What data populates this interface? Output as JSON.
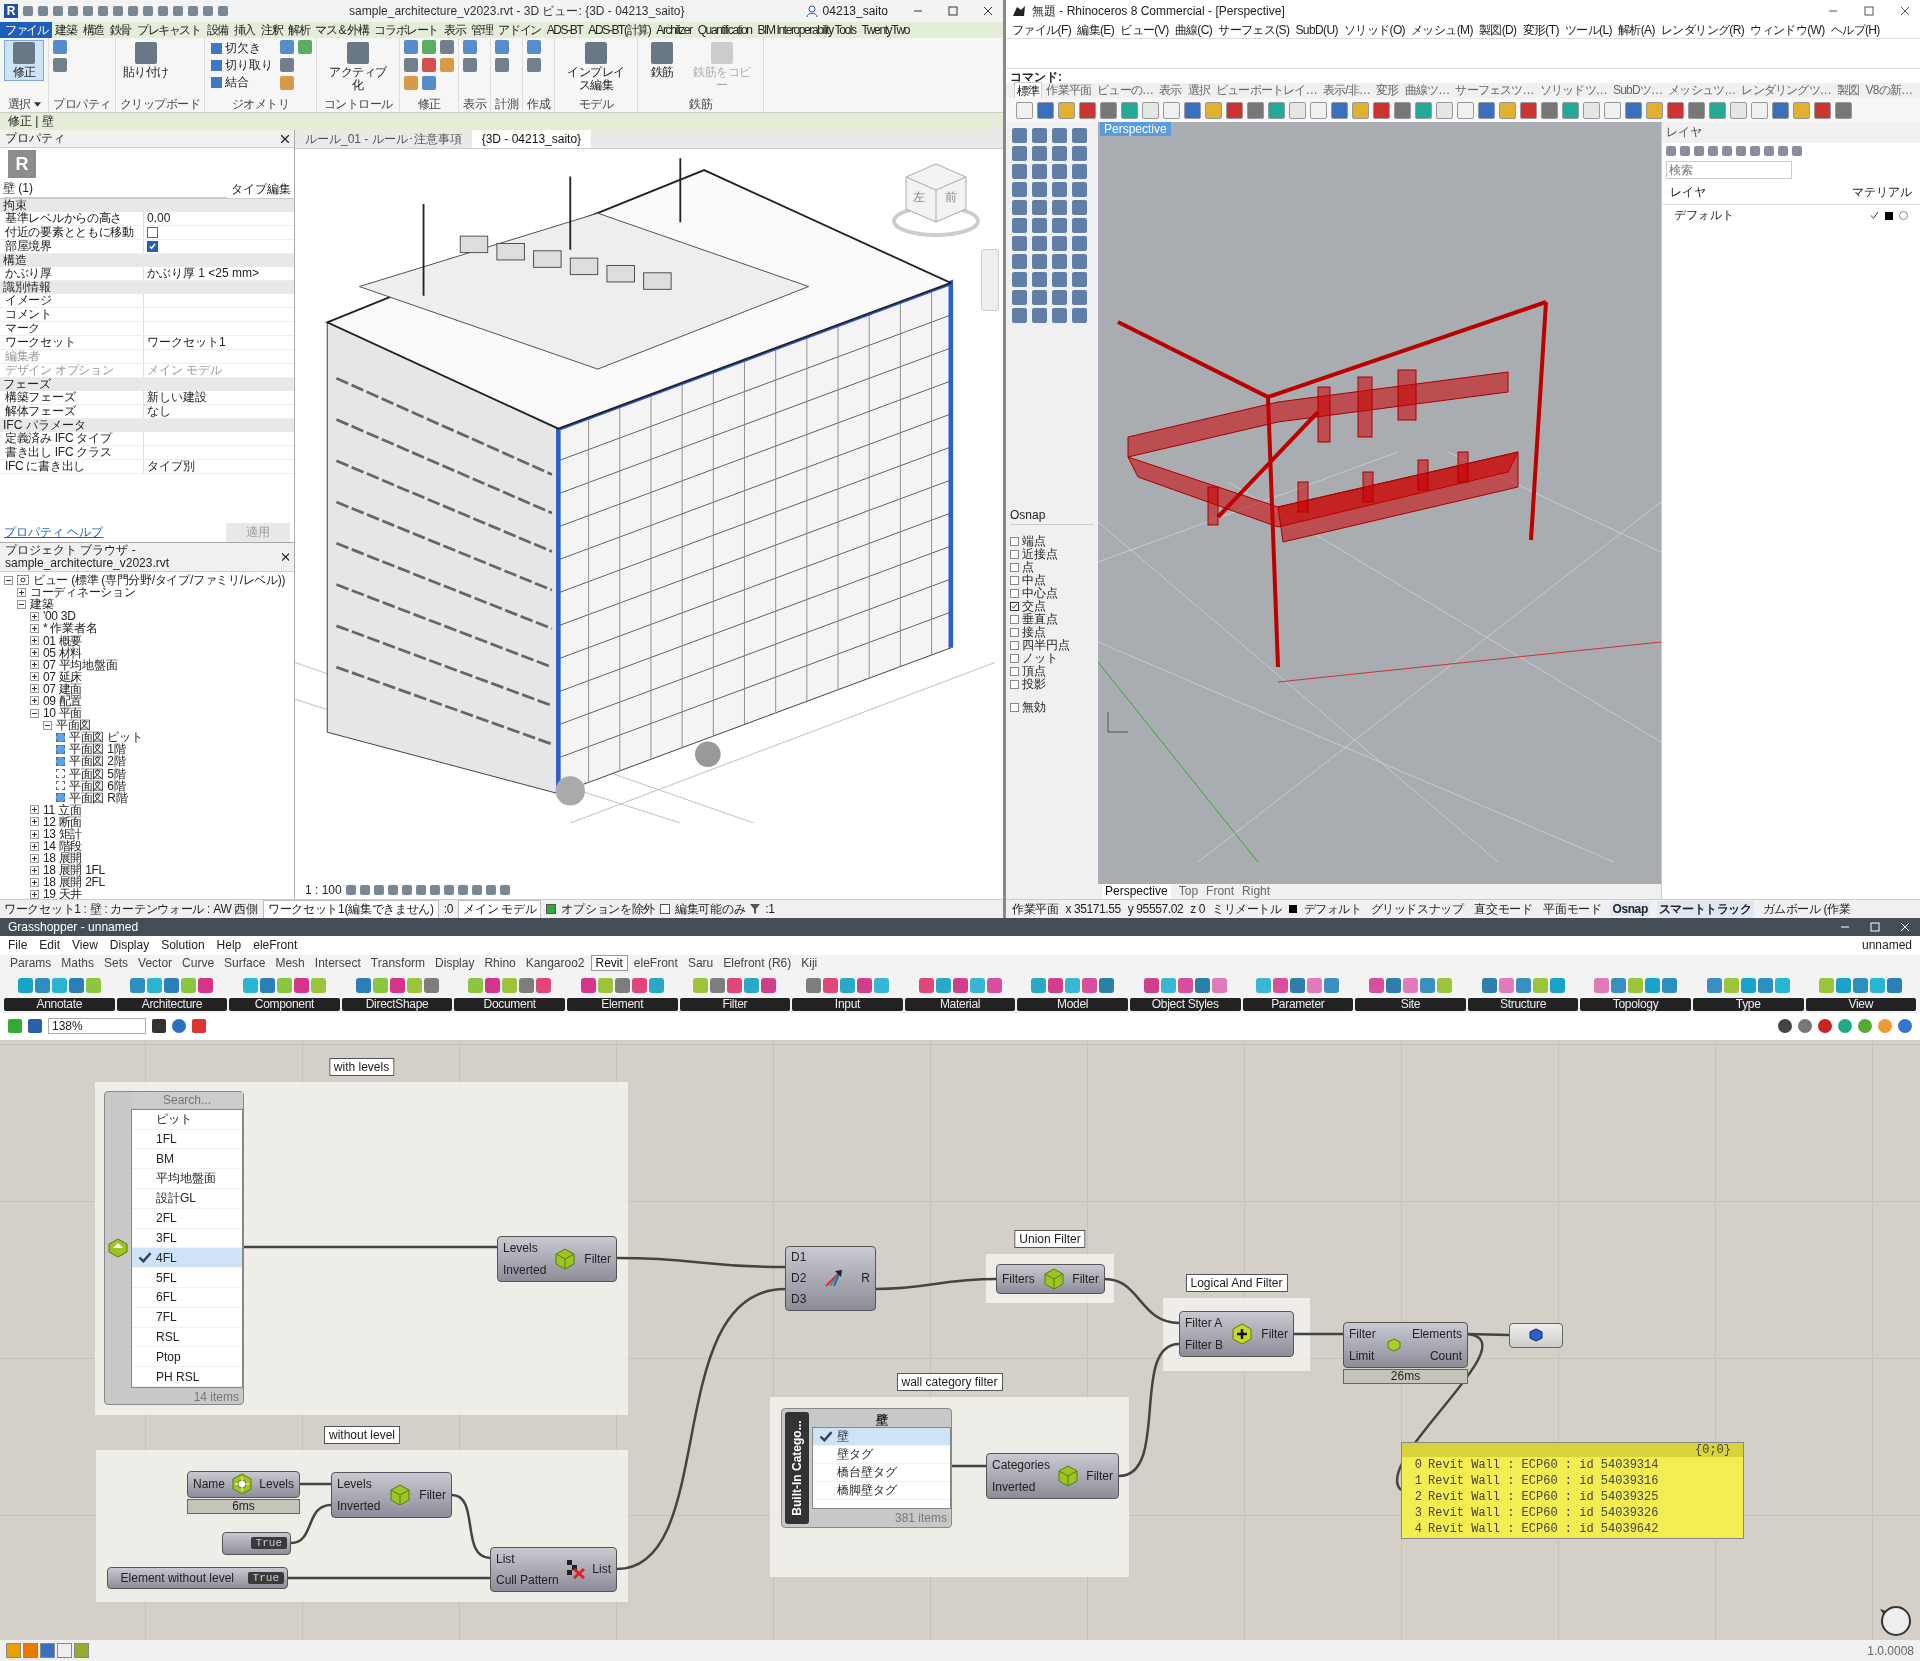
{
  "revit": {
    "app_logo": "R",
    "title": "sample_architecture_v2023.rvt - 3D ビュー: {3D - 04213_saito}",
    "user": "04213_saito",
    "tabs": [
      {
        "label": "ファイル",
        "selected": true
      },
      {
        "label": "建築",
        "selected": false
      },
      {
        "label": "構造",
        "selected": false
      },
      {
        "label": "鉄骨",
        "selected": false
      },
      {
        "label": "プレキャスト",
        "selected": false
      },
      {
        "label": "設備",
        "selected": false
      },
      {
        "label": "挿入",
        "selected": false
      },
      {
        "label": "注釈",
        "selected": false
      },
      {
        "label": "解析",
        "selected": false
      },
      {
        "label": "マス & 外構",
        "selected": false
      },
      {
        "label": "コラボレート",
        "selected": false
      },
      {
        "label": "表示",
        "selected": false
      },
      {
        "label": "管理",
        "selected": false
      },
      {
        "label": "アドイン",
        "selected": false
      },
      {
        "label": "ADS-BT",
        "selected": false
      },
      {
        "label": "ADS-BT(計算)",
        "selected": false
      },
      {
        "label": "Archilizer",
        "selected": false
      },
      {
        "label": "Quantification",
        "selected": false
      },
      {
        "label": "BIM Interoperability Tools",
        "selected": false
      },
      {
        "label": "TwentyTwo",
        "selected": false
      }
    ],
    "ribbon": [
      {
        "label": "選択",
        "dropdown": true,
        "buttons": [
          {
            "label": "修正",
            "kind": "large",
            "selected": true,
            "disabled": false
          }
        ]
      },
      {
        "label": "プロパティ",
        "dropdown": false
      },
      {
        "label": "クリップボード",
        "dropdown": false,
        "buttons": [
          {
            "label": "貼り付け",
            "kind": "large",
            "selected": false,
            "disabled": false
          }
        ]
      },
      {
        "label": "ジオメトリ",
        "dropdown": false,
        "buttons": [
          {
            "label": "切欠き",
            "kind": "small",
            "selected": false,
            "disabled": false
          },
          {
            "label": "切り取り",
            "kind": "small",
            "selected": false,
            "disabled": false
          },
          {
            "label": "結合",
            "kind": "small",
            "selected": false,
            "disabled": false
          }
        ]
      },
      {
        "label": "コントロール",
        "dropdown": false,
        "buttons": [
          {
            "label": "アクティブ化",
            "kind": "large",
            "selected": false,
            "disabled": false
          }
        ]
      },
      {
        "label": "修正",
        "dropdown": false
      },
      {
        "label": "表示",
        "dropdown": false
      },
      {
        "label": "計測",
        "dropdown": false
      },
      {
        "label": "作成",
        "dropdown": false
      },
      {
        "label": "モデル",
        "dropdown": false,
        "buttons": [
          {
            "label": "インプレイス編集",
            "kind": "large",
            "selected": false,
            "disabled": false
          }
        ]
      },
      {
        "label": "鉄筋",
        "dropdown": false,
        "buttons": [
          {
            "label": "鉄筋",
            "kind": "large",
            "selected": false,
            "disabled": false
          },
          {
            "label": "鉄筋をコピー",
            "kind": "large",
            "selected": false,
            "disabled": true
          }
        ]
      }
    ],
    "context": "修正 | 壁",
    "properties": {
      "title": "プロパティ",
      "logo": "R",
      "type_selector": "壁 (1)",
      "edit_type": "タイプ編集",
      "sections": [
        {
          "title": "拘束",
          "rows": [
            {
              "label": "基準レベルからの高さ",
              "kind": "text",
              "value": "0.00",
              "disabled": false
            },
            {
              "label": "付近の要素とともに移動",
              "kind": "checkbox",
              "checked": false,
              "disabled": false
            },
            {
              "label": "部屋境界",
              "kind": "checkbox",
              "checked": true,
              "disabled": false
            }
          ]
        },
        {
          "title": "構造",
          "rows": [
            {
              "label": "かぶり厚",
              "kind": "text",
              "value": "かぶり厚 1 <25 mm>",
              "disabled": false
            }
          ]
        },
        {
          "title": "識別情報",
          "rows": [
            {
              "label": "イメージ",
              "kind": "text",
              "disabled": false
            },
            {
              "label": "コメント",
              "kind": "text",
              "disabled": false
            },
            {
              "label": "マーク",
              "kind": "text",
              "disabled": false
            },
            {
              "label": "ワークセット",
              "kind": "text",
              "value": "ワークセット1",
              "disabled": false
            },
            {
              "label": "編集者",
              "kind": "text",
              "disabled": true
            },
            {
              "label": "デザイン オプション",
              "kind": "text",
              "value": "メイン モデル",
              "disabled": true
            }
          ]
        },
        {
          "title": "フェーズ",
          "rows": [
            {
              "label": "構築フェーズ",
              "kind": "text",
              "value": "新しい建設",
              "disabled": false
            },
            {
              "label": "解体フェーズ",
              "kind": "text",
              "value": "なし",
              "disabled": false
            }
          ]
        },
        {
          "title": "IFC パラメータ",
          "rows": [
            {
              "label": "定義済み IFC タイプ",
              "kind": "text",
              "disabled": false
            },
            {
              "label": "書き出し IFC クラス",
              "kind": "text",
              "disabled": false
            },
            {
              "label": "IFC に書き出し",
              "kind": "text",
              "value": "タイプ別",
              "disabled": false
            }
          ]
        }
      ],
      "help_link": "プロパティ ヘルプ",
      "apply": "適用"
    },
    "browser": {
      "title": "プロジェクト ブラウザ - sample_architecture_v2023.rvt",
      "tree": [
        {
          "label": "ビュー (標準 (専門分野/タイプ/ファミリ/レベル))",
          "kind": "root",
          "expanded": true,
          "children": [
            {
              "label": "コーディネーション",
              "kind": "folder",
              "expanded": false
            },
            {
              "label": "建築",
              "kind": "folder",
              "expanded": true,
              "children": [
                {
                  "label": "'00 3D",
                  "kind": "folder",
                  "expanded": false
                },
                {
                  "label": "* 作業者名",
                  "kind": "folder",
                  "expanded": false
                },
                {
                  "label": "01 概要",
                  "kind": "folder",
                  "expanded": false
                },
                {
                  "label": "05 材料",
                  "kind": "folder",
                  "expanded": false
                },
                {
                  "label": "07 平均地盤面",
                  "kind": "folder",
                  "expanded": false
                },
                {
                  "label": "07 延床",
                  "kind": "folder",
                  "expanded": false
                },
                {
                  "label": "07 建面",
                  "kind": "folder",
                  "expanded": false
                },
                {
                  "label": "09 配置",
                  "kind": "folder",
                  "expanded": false
                },
                {
                  "label": "10 平面",
                  "kind": "folder",
                  "expanded": true,
                  "children": [
                    {
                      "label": "平面図",
                      "kind": "folder",
                      "expanded": true,
                      "children": [
                        {
                          "label": "平面図 ピット",
                          "kind": "view",
                          "checked": true
                        },
                        {
                          "label": "平面図 1階",
                          "kind": "view",
                          "checked": true
                        },
                        {
                          "label": "平面図 2階",
                          "kind": "view",
                          "checked": true
                        },
                        {
                          "label": "平面図 5階",
                          "kind": "view",
                          "checked": false
                        },
                        {
                          "label": "平面図 6階",
                          "kind": "view",
                          "checked": false
                        },
                        {
                          "label": "平面図 R階",
                          "kind": "view",
                          "checked": true
                        }
                      ]
                    }
                  ]
                },
                {
                  "label": "11 立面",
                  "kind": "folder",
                  "expanded": false
                },
                {
                  "label": "12 断面",
                  "kind": "folder",
                  "expanded": false
                },
                {
                  "label": "13 矩計",
                  "kind": "folder",
                  "expanded": false
                },
                {
                  "label": "14 階段",
                  "kind": "folder",
                  "expanded": false
                },
                {
                  "label": "18 展開",
                  "kind": "folder",
                  "expanded": false
                },
                {
                  "label": "18 展開 1FL",
                  "kind": "folder",
                  "expanded": false
                },
                {
                  "label": "18 展開 2FL",
                  "kind": "folder",
                  "expanded": false
                },
                {
                  "label": "19 天井",
                  "kind": "folder",
                  "expanded": false
                }
              ]
            }
          ]
        }
      ]
    },
    "view_tabs": [
      {
        "label": "ルール_01 - ルール･注意事項",
        "selected": false
      },
      {
        "label": "{3D - 04213_saito}",
        "selected": true
      }
    ],
    "view_cube": [
      "左",
      "前"
    ],
    "scale": "1 : 100",
    "status": {
      "selection": "ワークセット1 : 壁 : カーテンウォール : AW 西側",
      "workset": "ワークセット1(編集できません)",
      "count": ":0",
      "design_option": "メイン モデル",
      "options": [
        {
          "label": "オプションを除外",
          "checked": true
        },
        {
          "label": "編集可能のみ",
          "checked": false
        }
      ],
      "filter": ":1"
    }
  },
  "rhino": {
    "title": "無題 - Rhinoceros 8 Commercial - [Perspective]",
    "menu": [
      "ファイル(F)",
      "編集(E)",
      "ビュー(V)",
      "曲線(C)",
      "サーフェス(S)",
      "SubD(U)",
      "ソリッド(O)",
      "メッシュ(M)",
      "製図(D)",
      "変形(T)",
      "ツール(L)",
      "解析(A)",
      "レンダリング(R)",
      "ウィンドウ(W)",
      "ヘルプ(H)"
    ],
    "command_prompt": "コマンド:",
    "toolbar_tabs": [
      {
        "label": "標準",
        "selected": true
      },
      {
        "label": "作業平面",
        "selected": false
      },
      {
        "label": "ビューの…",
        "selected": false
      },
      {
        "label": "表示",
        "selected": false
      },
      {
        "label": "選択",
        "selected": false
      },
      {
        "label": "ビューポートレイ…",
        "selected": false
      },
      {
        "label": "表示/非…",
        "selected": false
      },
      {
        "label": "変形",
        "selected": false
      },
      {
        "label": "曲線ツ…",
        "selected": false
      },
      {
        "label": "サーフェスツ…",
        "selected": false
      },
      {
        "label": "ソリッドツ…",
        "selected": false
      },
      {
        "label": "SubDツ…",
        "selected": false
      },
      {
        "label": "メッシュツ…",
        "selected": false
      },
      {
        "label": "レンダリングツ…",
        "selected": false
      },
      {
        "label": "製図",
        "selected": false
      },
      {
        "label": "V8の新…",
        "selected": false
      }
    ],
    "viewport_label": "Perspective",
    "osnap": {
      "title": "Osnap",
      "items": [
        {
          "label": "端点",
          "checked": false
        },
        {
          "label": "近接点",
          "checked": false
        },
        {
          "label": "点",
          "checked": false
        },
        {
          "label": "中点",
          "checked": false
        },
        {
          "label": "中心点",
          "checked": false
        },
        {
          "label": "交点",
          "checked": true
        },
        {
          "label": "垂直点",
          "checked": false
        },
        {
          "label": "接点",
          "checked": false
        },
        {
          "label": "四半円点",
          "checked": false
        },
        {
          "label": "ノット",
          "checked": false
        },
        {
          "label": "頂点",
          "checked": false
        },
        {
          "label": "投影",
          "checked": false
        }
      ],
      "disable": {
        "label": "無効",
        "checked": false
      }
    },
    "layers": {
      "title": "レイヤ",
      "search_placeholder": "検索",
      "columns": [
        "レイヤ",
        "マテリアル"
      ],
      "rows": [
        {
          "name": "デフォルト",
          "current": true,
          "color": "#000000"
        }
      ]
    },
    "viewport_tabs": [
      {
        "label": "Perspective",
        "selected": true
      },
      {
        "label": "Top",
        "selected": false
      },
      {
        "label": "Front",
        "selected": false
      },
      {
        "label": "Right",
        "selected": false
      }
    ],
    "status": {
      "cplane": "作業平面",
      "x": "x 35171.55",
      "y": "y 95557.02",
      "z": "z 0",
      "units": "ミリメートル",
      "layer": "デフォルト",
      "toggles": [
        {
          "label": "グリッドスナップ",
          "on": false
        },
        {
          "label": "直交モード",
          "on": false
        },
        {
          "label": "平面モード",
          "on": false
        },
        {
          "label": "Osnap",
          "on": true
        },
        {
          "label": "スマートトラック",
          "on": true
        },
        {
          "label": "ガムボール (作業",
          "on": false
        }
      ]
    }
  },
  "grasshopper": {
    "title": "Grasshopper - unnamed",
    "menu": [
      "File",
      "Edit",
      "View",
      "Display",
      "Solution",
      "Help",
      "eleFront"
    ],
    "doc_name": "unnamed",
    "tabs": [
      {
        "label": "Params",
        "selected": false
      },
      {
        "label": "Maths",
        "selected": false
      },
      {
        "label": "Sets",
        "selected": false
      },
      {
        "label": "Vector",
        "selected": false
      },
      {
        "label": "Curve",
        "selected": false
      },
      {
        "label": "Surface",
        "selected": false
      },
      {
        "label": "Mesh",
        "selected": false
      },
      {
        "label": "Intersect",
        "selected": false
      },
      {
        "label": "Transform",
        "selected": false
      },
      {
        "label": "Display",
        "selected": false
      },
      {
        "label": "Rhino",
        "selected": false
      },
      {
        "label": "Kangaroo2",
        "selected": false
      },
      {
        "label": "Revit",
        "selected": true
      },
      {
        "label": "eleFront",
        "selected": false
      },
      {
        "label": "Saru",
        "selected": false
      },
      {
        "label": "Elefront (R6)",
        "selected": false
      },
      {
        "label": "Kiji",
        "selected": false
      }
    ],
    "component_groups": [
      "Annotate",
      "Architecture",
      "Component",
      "DirectShape",
      "Document",
      "Element",
      "Filter",
      "Input",
      "Material",
      "Model",
      "Object Styles",
      "Parameter",
      "Site",
      "Structure",
      "Topology",
      "Type",
      "View"
    ],
    "zoom": "138%",
    "groups": [
      "with levels",
      "without level",
      "Union Filter",
      "Logical And Filter",
      "wall category filter"
    ],
    "level_list": {
      "search_placeholder": "Search...",
      "items": [
        {
          "label": "ピット",
          "selected": false
        },
        {
          "label": "1FL",
          "selected": false
        },
        {
          "label": "BM",
          "selected": false
        },
        {
          "label": "平均地盤面",
          "selected": false
        },
        {
          "label": "設計GL",
          "selected": false
        },
        {
          "label": "2FL",
          "selected": false
        },
        {
          "label": "3FL",
          "selected": false
        },
        {
          "label": "4FL",
          "selected": true
        },
        {
          "label": "5FL",
          "selected": false
        },
        {
          "label": "6FL",
          "selected": false
        },
        {
          "label": "7FL",
          "selected": false
        },
        {
          "label": "RSL",
          "selected": false
        },
        {
          "label": "Ptop",
          "selected": false
        },
        {
          "label": "PH RSL",
          "selected": false
        }
      ],
      "footer": "14 items"
    },
    "category_list": {
      "title": "Built-In Catego...",
      "header": "壁",
      "items": [
        {
          "label": "壁",
          "selected": true
        },
        {
          "label": "壁タグ",
          "selected": false
        },
        {
          "label": "橋台壁タグ",
          "selected": false
        },
        {
          "label": "橋脚壁タグ",
          "selected": false
        }
      ],
      "footer": "381 items"
    },
    "components": [
      {
        "kind": "filter",
        "inputs": [
          "Levels",
          "Inverted"
        ],
        "outputs": [
          "Filter"
        ]
      },
      {
        "kind": "merge",
        "inputs": [
          "D1",
          "D2",
          "D3"
        ],
        "outputs": [
          "R"
        ]
      },
      {
        "kind": "filter",
        "inputs": [
          "Filters"
        ],
        "outputs": [
          "Filter"
        ]
      },
      {
        "kind": "and",
        "inputs": [
          "Filter A",
          "Filter B"
        ],
        "outputs": [
          "Filter"
        ]
      },
      {
        "kind": "collector",
        "inputs": [
          "Filter",
          "Limit"
        ],
        "outputs": [
          "Elements",
          "Count"
        ],
        "timing": "26ms"
      },
      {
        "kind": "levels",
        "inputs": [
          "Name"
        ],
        "outputs": [
          "Levels"
        ],
        "timing": "6ms"
      },
      {
        "kind": "filter",
        "inputs": [
          "Levels",
          "Inverted"
        ],
        "outputs": [
          "Filter"
        ]
      },
      {
        "kind": "cull",
        "inputs": [
          "List",
          "Cull Pattern"
        ],
        "outputs": [
          "List"
        ]
      },
      {
        "kind": "filter",
        "inputs": [
          "Categories",
          "Inverted"
        ],
        "outputs": [
          "Filter"
        ]
      }
    ],
    "toggles": [
      {
        "value": "True"
      },
      {
        "label": "Element without level",
        "value": "True"
      }
    ],
    "panel": {
      "path": "{0;0}",
      "rows": [
        {
          "index": "0",
          "text": "Revit Wall : ECP60 : id 54039314"
        },
        {
          "index": "1",
          "text": "Revit Wall : ECP60 : id 54039316"
        },
        {
          "index": "2",
          "text": "Revit Wall : ECP60 : id 54039325"
        },
        {
          "index": "3",
          "text": "Revit Wall : ECP60 : id 54039326"
        },
        {
          "index": "4",
          "text": "Revit Wall : ECP60 : id 54039642"
        }
      ]
    },
    "version": "1.0.0008"
  }
}
